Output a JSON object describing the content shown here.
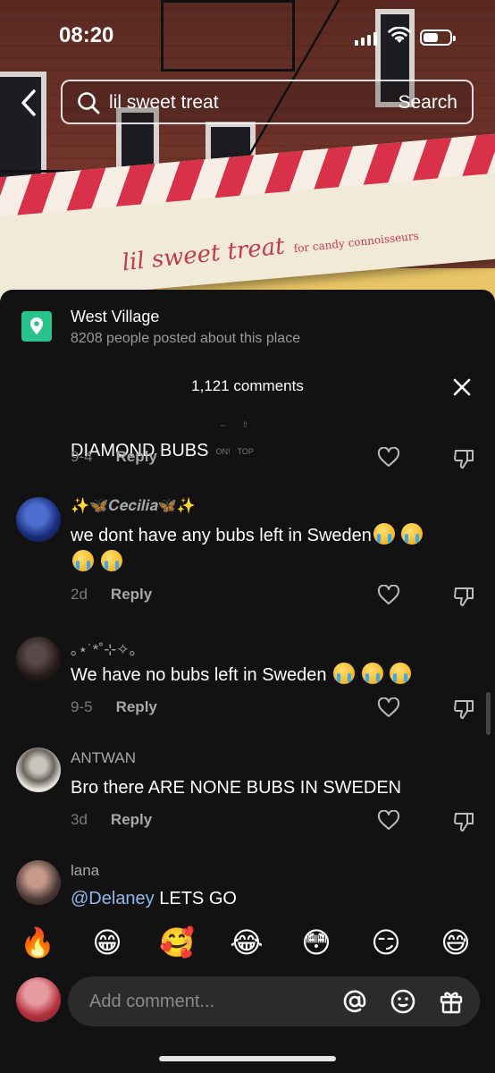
{
  "status_bar": {
    "time": "08:20"
  },
  "photo": {
    "sign_main": "lil sweet treat",
    "sign_tagline": "for candy connoisseurs"
  },
  "search": {
    "query": "lil sweet treat",
    "button_label": "Search"
  },
  "place": {
    "name": "West Village",
    "subtitle": "8208 people posted about this place"
  },
  "comments_header": {
    "count_label": "1,121 comments"
  },
  "comments": [
    {
      "author": "",
      "text": "DIAMOND BUBS",
      "badges": [
        "ON!",
        "TOP"
      ],
      "date": "9-4",
      "reply_label": "Reply"
    },
    {
      "author": "✨🦋𝑪𝒆𝒄𝒊𝒍𝒊𝒂🦋✨",
      "text": "we dont have any bubs left in Sweden",
      "date": "2d",
      "reply_label": "Reply"
    },
    {
      "author": "｡⋆˙*˚⊹✧｡",
      "text": "We have no bubs left in Sweden",
      "date": "9-5",
      "reply_label": "Reply"
    },
    {
      "author": "ANTWAN",
      "text": "Bro there ARE NONE BUBS IN SWEDEN",
      "date": "3d",
      "reply_label": "Reply"
    },
    {
      "author": "lana",
      "mention": "@Delaney",
      "text": " LETS GO"
    }
  ],
  "quick_emojis": [
    "🔥",
    "😁",
    "🥰",
    "😂",
    "😳",
    "😏",
    "😅"
  ],
  "input": {
    "placeholder": "Add comment..."
  },
  "icons": [
    "back-chevron-icon",
    "search-icon",
    "location-pin-icon",
    "close-icon",
    "heart-icon",
    "dislike-icon",
    "at-icon",
    "emoji-icon",
    "gift-icon"
  ],
  "colors": {
    "sheet_bg": "#121212",
    "place_pin": "#29c28a",
    "mention": "#8fb8ec"
  }
}
